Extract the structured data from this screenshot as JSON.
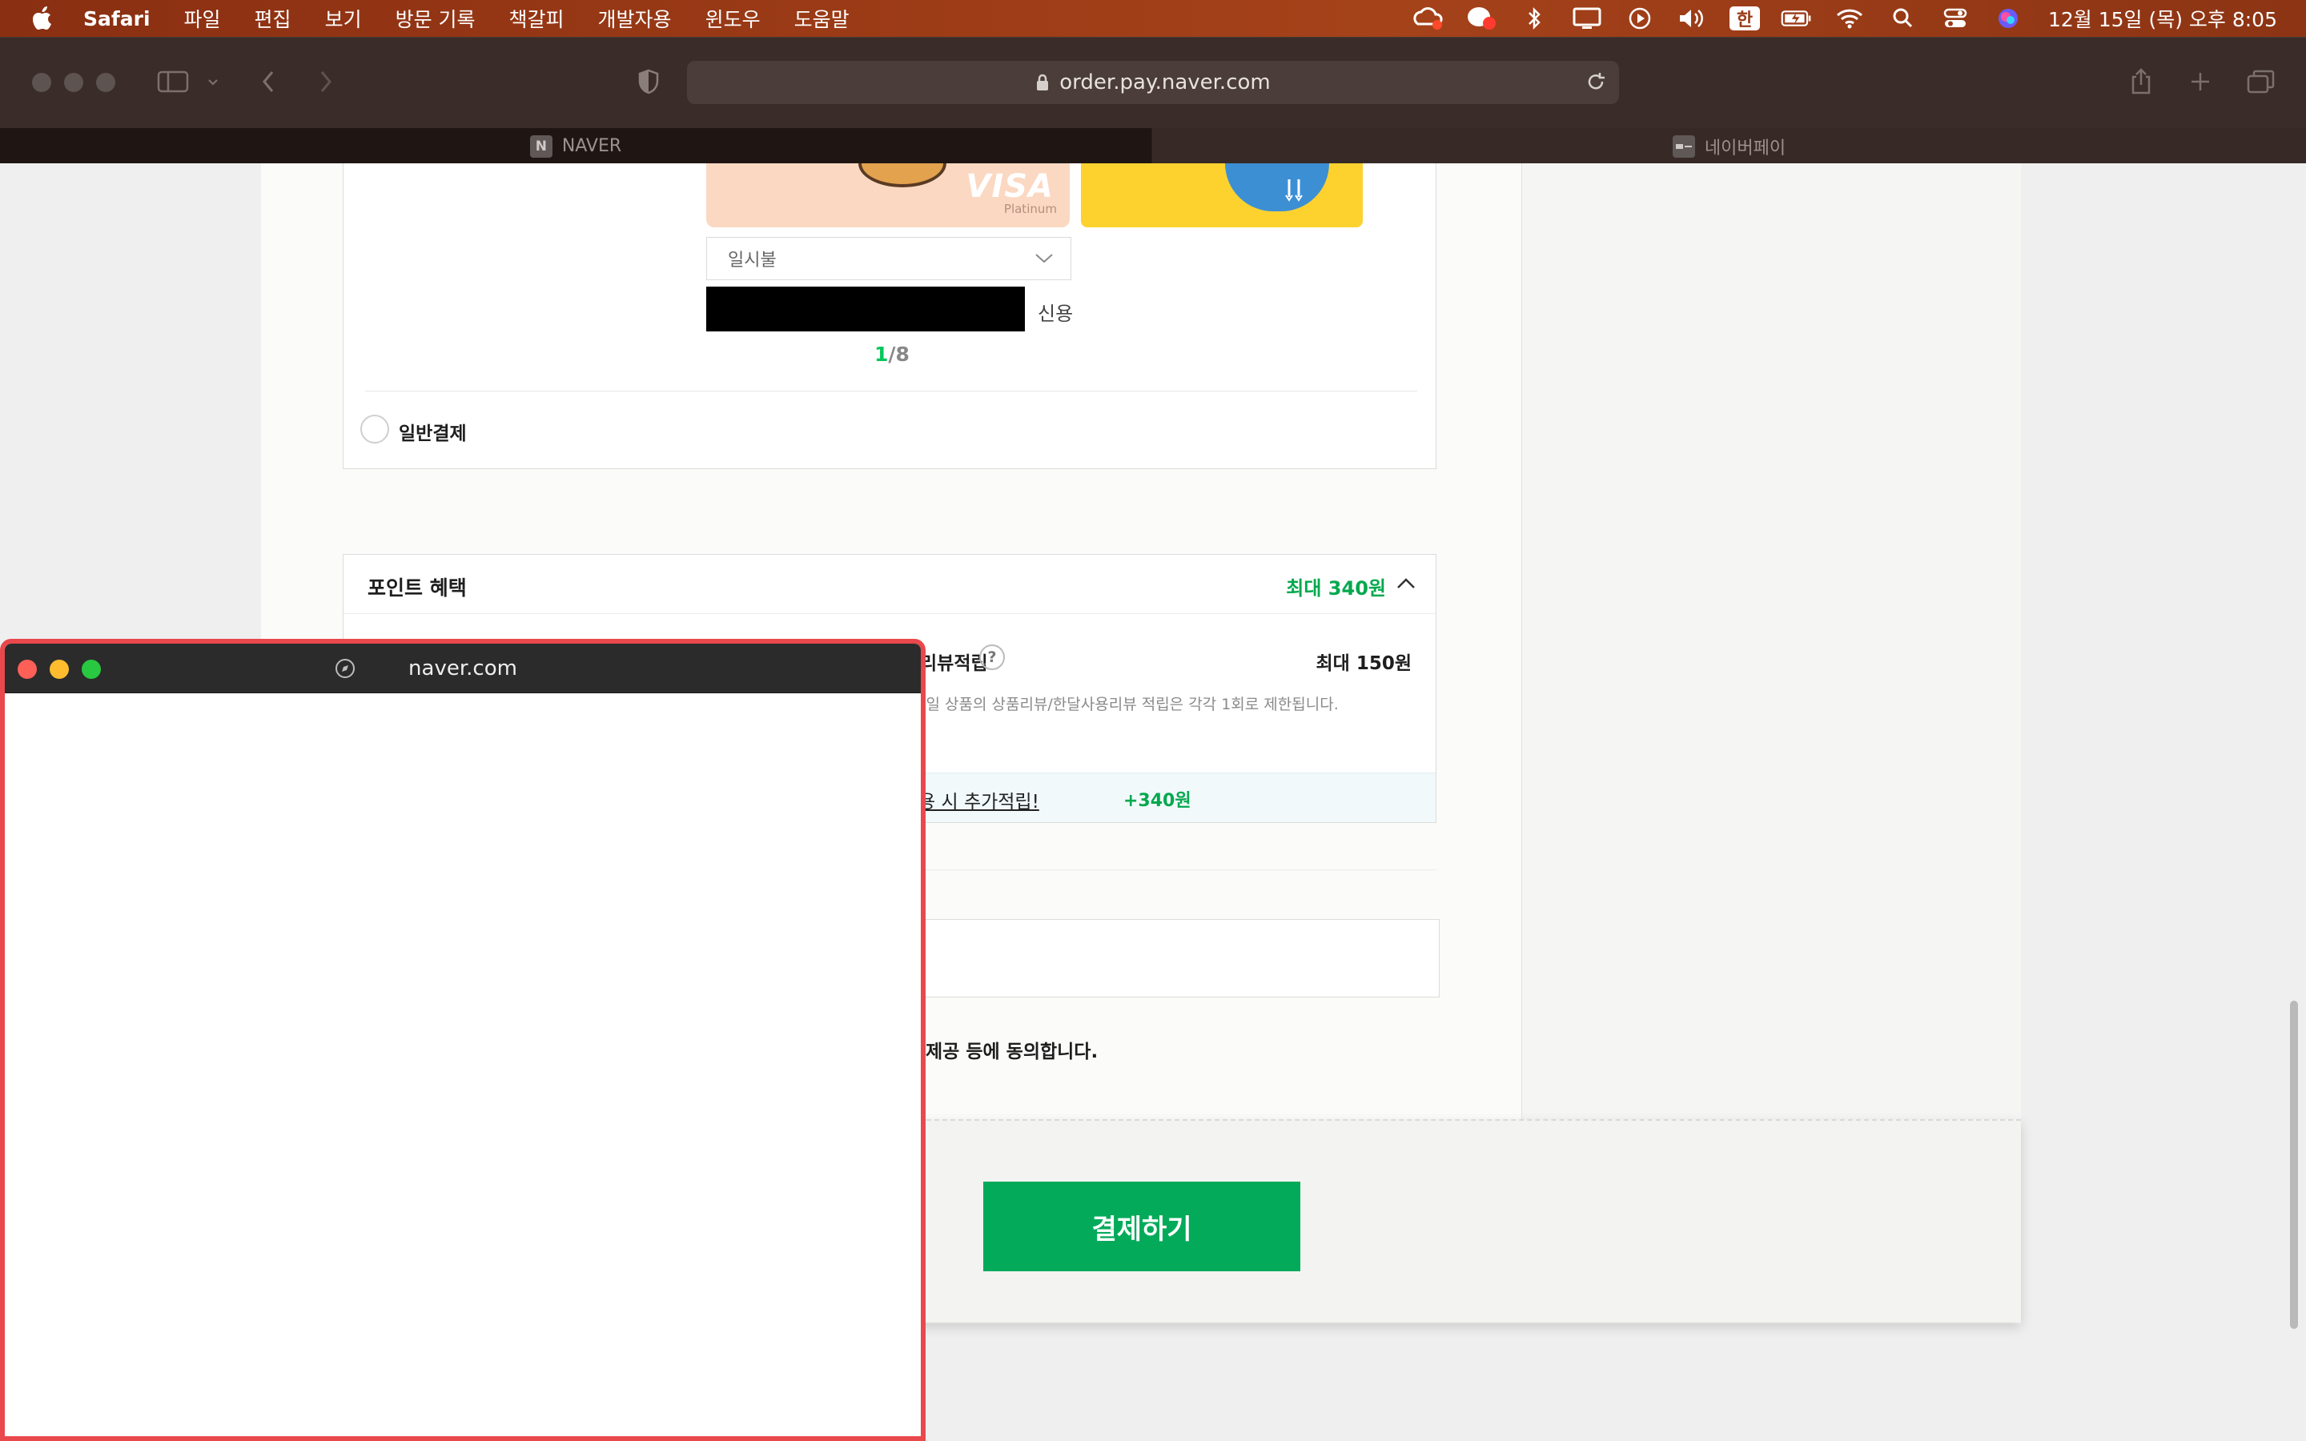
{
  "menubar": {
    "app_name": "Safari",
    "menus": [
      "파일",
      "편집",
      "보기",
      "방문 기록",
      "책갈피",
      "개발자용",
      "윈도우",
      "도움말"
    ],
    "ime": "한",
    "clock": "12월 15일 (목) 오후 8:05"
  },
  "browser": {
    "url": "order.pay.naver.com",
    "tabs": [
      {
        "label": "NAVER",
        "favicon": "N",
        "active": true
      },
      {
        "label": "네이버페이",
        "favicon": "",
        "active": false
      }
    ]
  },
  "payment": {
    "installment_value": "일시불",
    "credit_label": "신용",
    "pager_current": "1",
    "pager_total": "/8",
    "card_brand": "VISA",
    "card_tier": "Platinum",
    "general_payment_label": "일반결제"
  },
  "points": {
    "title": "포인트 혜택",
    "max_total": "최대 340원",
    "review_label": "리뷰적립",
    "review_help": "?",
    "review_max": "최대 150원",
    "review_note": "동일 상품의 상품리뷰/한달사용리뷰 적립은 각각 1회로 제한됩니다.",
    "extra_text": "용 시 추가적립!",
    "extra_amount": "+340원"
  },
  "agreement": {
    "text": "제공 등에 동의합니다."
  },
  "pay_button_label": "결제하기",
  "popup": {
    "url": "naver.com"
  },
  "colors": {
    "accent_green": "#03c75a",
    "pay_button": "#03aa5a",
    "popup_border": "#e9484c"
  }
}
